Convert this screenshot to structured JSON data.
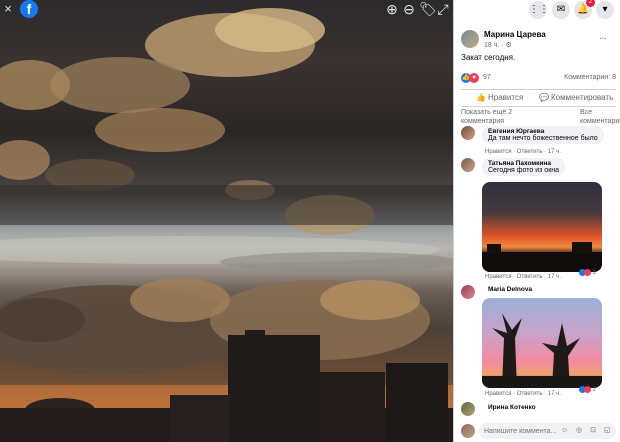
{
  "viewer": {
    "close_icon": "×",
    "logo": "f",
    "zoom_in_icon": "⊕",
    "zoom_out_icon": "⊖",
    "tag_icon": "🏷",
    "expand_icon": "⤢"
  },
  "topbar": {
    "menu_icon": "⋮⋮",
    "messenger_icon": "✉",
    "bell_icon": "🔔",
    "account_icon": "▾",
    "notifications_count": "2"
  },
  "post": {
    "author": "Марина Царева",
    "time": "18 ч. · ⚙",
    "more_icon": "···",
    "caption": "Закат сегодня.",
    "reactions_count": "97",
    "comments_label": "Комментарии: 8",
    "like_label": "Нравится",
    "comment_label": "Комментировать",
    "like_icon": "👍",
    "comment_icon": "💬",
    "show_more": "Показать ещё 2 комментария",
    "all_comments": "Все комментарии"
  },
  "comments": [
    {
      "name": "Евгения Юргаева",
      "text": "Да там нечто божественное было",
      "meta": "Нравится · Ответить · 17 ч."
    },
    {
      "name": "Татьяна Пахомкина",
      "text": "Сегодня фото из окна",
      "meta": "Нравится · Ответить · 17 ч.",
      "reactions": "1"
    },
    {
      "name": "Maria Delnova",
      "meta": "Нравится · Ответить · 17 ч.",
      "reactions": "2"
    },
    {
      "name": "Ирина Котенко"
    }
  ],
  "composer": {
    "placeholder": "Напишите коммента...",
    "icons": "☺ ◎ ⊡ ◱"
  },
  "colors": {
    "brand": "#1877f2",
    "love": "#f33e58",
    "notification": "#e41e3f"
  }
}
